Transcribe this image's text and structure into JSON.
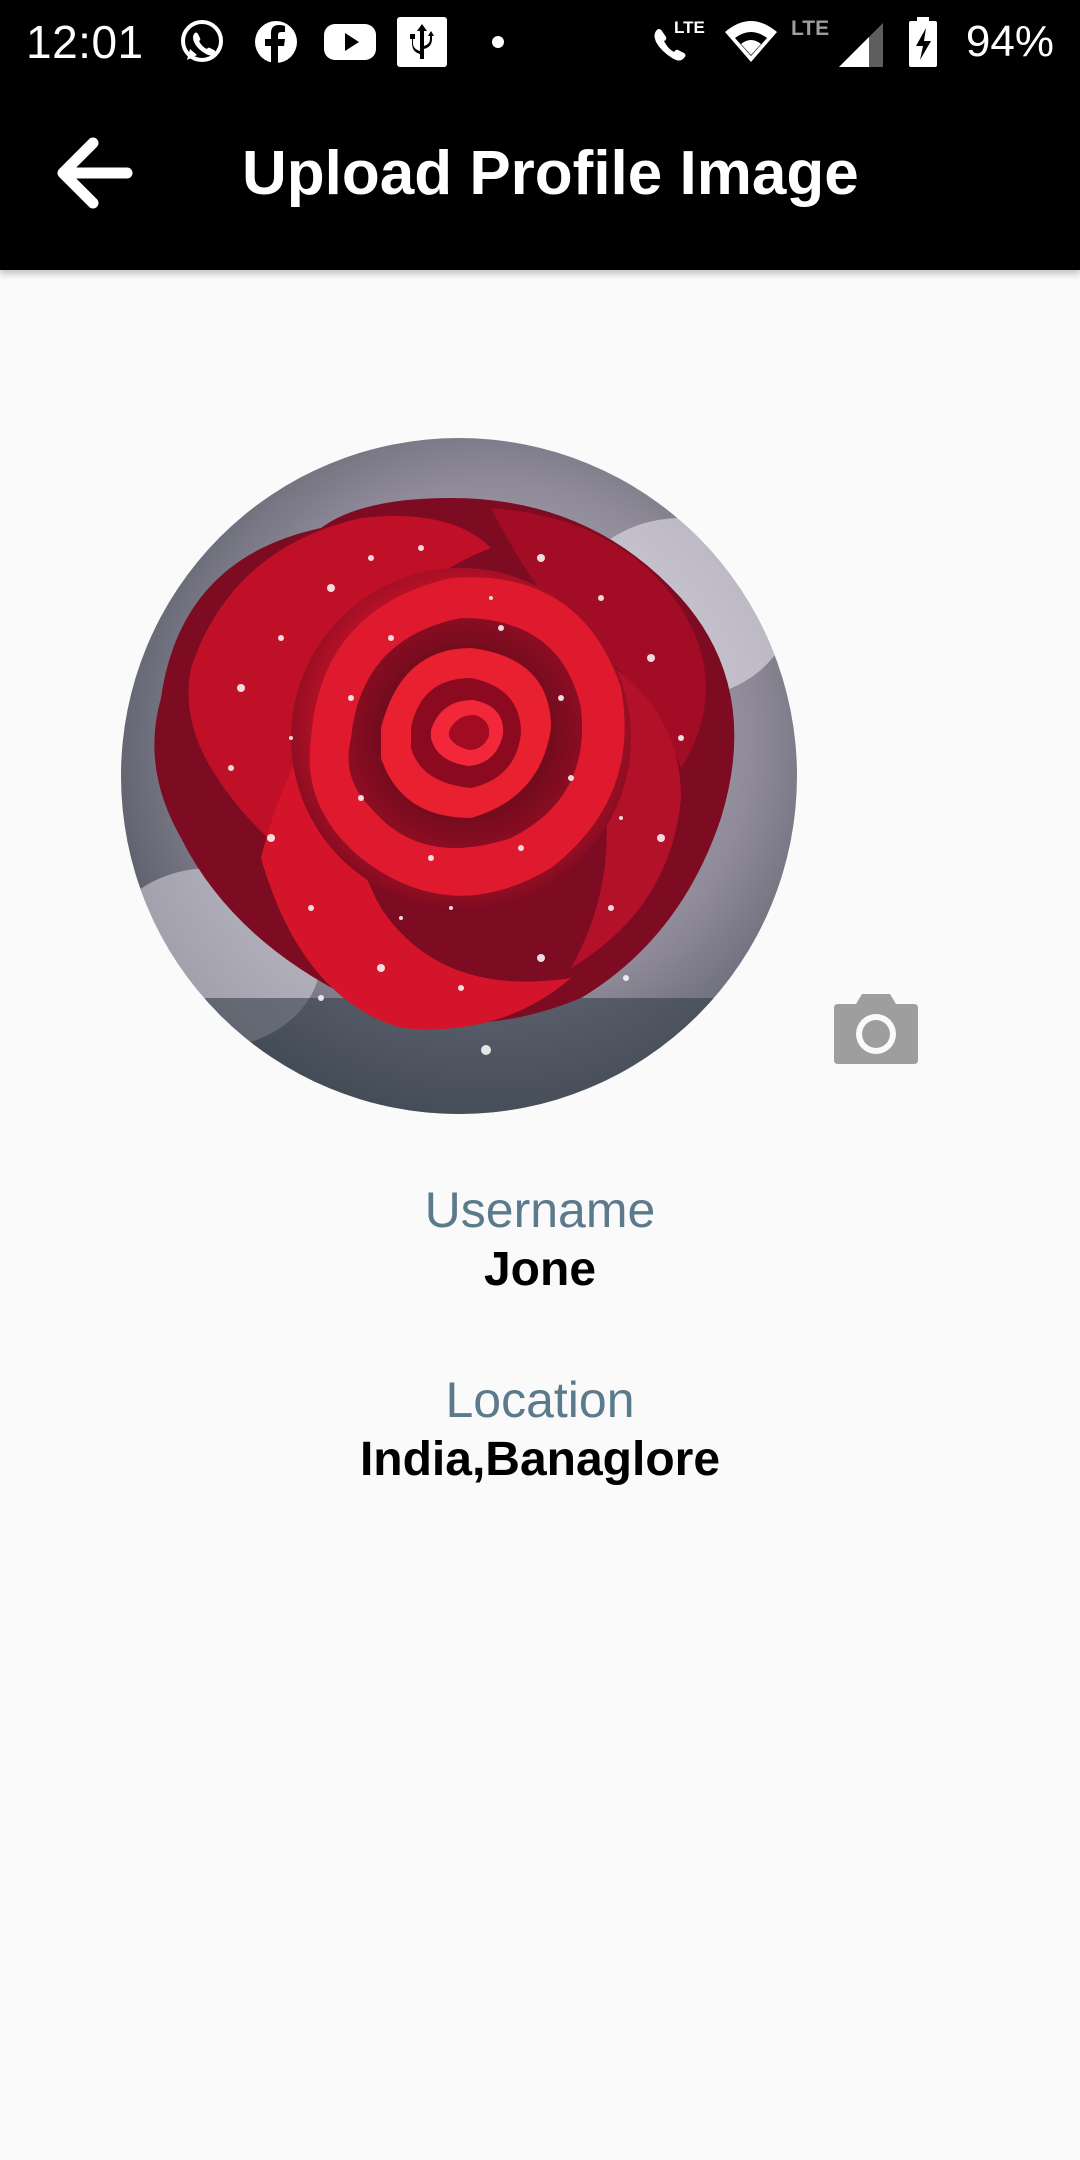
{
  "status_bar": {
    "time": "12:01",
    "battery_percent": "94%",
    "left_icons": [
      "whatsapp-icon",
      "facebook-icon",
      "youtube-icon",
      "usb-icon",
      "dot-icon"
    ],
    "right_icons": [
      "lte-call-icon",
      "wifi-icon",
      "signal-icon",
      "battery-charging-icon"
    ],
    "network_label": "LTE",
    "call_network_label": "LTE"
  },
  "app_bar": {
    "title": "Upload Profile Image",
    "back_icon": "arrow-back-icon",
    "background": "#000000"
  },
  "profile": {
    "image_icon": "rose-image",
    "camera_icon": "camera-icon",
    "camera_color": "#9e9e9e"
  },
  "info": {
    "username_label": "Username",
    "username_value": "Jone",
    "location_label": "Location",
    "location_value": "India,Banaglore",
    "label_color": "#5b7a8c"
  }
}
